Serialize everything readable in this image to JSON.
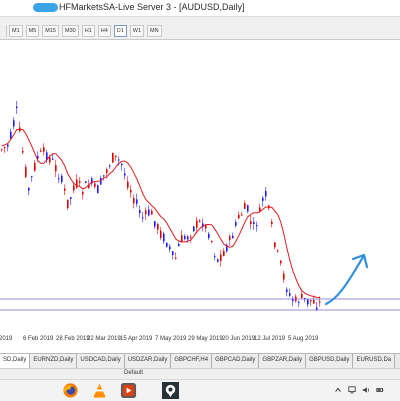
{
  "window": {
    "title": "HFMarketsSA-Live Server 3 - [AUDUSD,Daily]"
  },
  "toolbar": {
    "timeframes": [
      {
        "label": "M1",
        "active": false
      },
      {
        "label": "M5",
        "active": false
      },
      {
        "label": "M15",
        "active": false
      },
      {
        "label": "M30",
        "active": false
      },
      {
        "label": "H1",
        "active": false
      },
      {
        "label": "H4",
        "active": false
      },
      {
        "label": "D1",
        "active": true
      },
      {
        "label": "W1",
        "active": false
      },
      {
        "label": "MN",
        "active": false
      }
    ]
  },
  "chart": {
    "symbol": "AUDUSD",
    "timeframe": "Daily",
    "x_axis_labels": [
      "n 2019",
      "6 Feb 2019",
      "28 Feb 2019",
      "22 Mar 2019",
      "15 Apr 2019",
      "7 May 2019",
      "29 May 2019",
      "20 Jun 2019",
      "12 Jul 2019",
      "5 Aug 2019"
    ],
    "colors": {
      "bull_candle": "#1a1aff",
      "bear_candle": "#e00000",
      "moving_average": "#e01b1b",
      "horizontal_line": "#7b68c9",
      "arrow": "#2f8fe0"
    },
    "moving_average": "red line",
    "annotation": "hand-drawn blue arrow pointing up-right"
  },
  "tabs": [
    {
      "label": "SD,Daily",
      "active": true
    },
    {
      "label": "EURNZD,Daily",
      "active": false
    },
    {
      "label": "USDCAD,Daily",
      "active": false
    },
    {
      "label": "USDZAR,Daily",
      "active": false
    },
    {
      "label": "GBPCHF,H4",
      "active": false
    },
    {
      "label": "GBPCAD,Daily",
      "active": false
    },
    {
      "label": "GBPZAR,Daily",
      "active": false
    },
    {
      "label": "GBPUSD,Daily",
      "active": false
    },
    {
      "label": "EURUSD,Da",
      "active": false
    }
  ],
  "status_bar": {
    "profile": "Default"
  },
  "taskbar": {
    "icons": [
      "firefox-icon",
      "vlc-icon",
      "media-player-icon",
      "maps-pin-icon"
    ],
    "tray": [
      "up-arrow-icon",
      "network-icon",
      "volume-icon",
      "battery-icon"
    ]
  }
}
